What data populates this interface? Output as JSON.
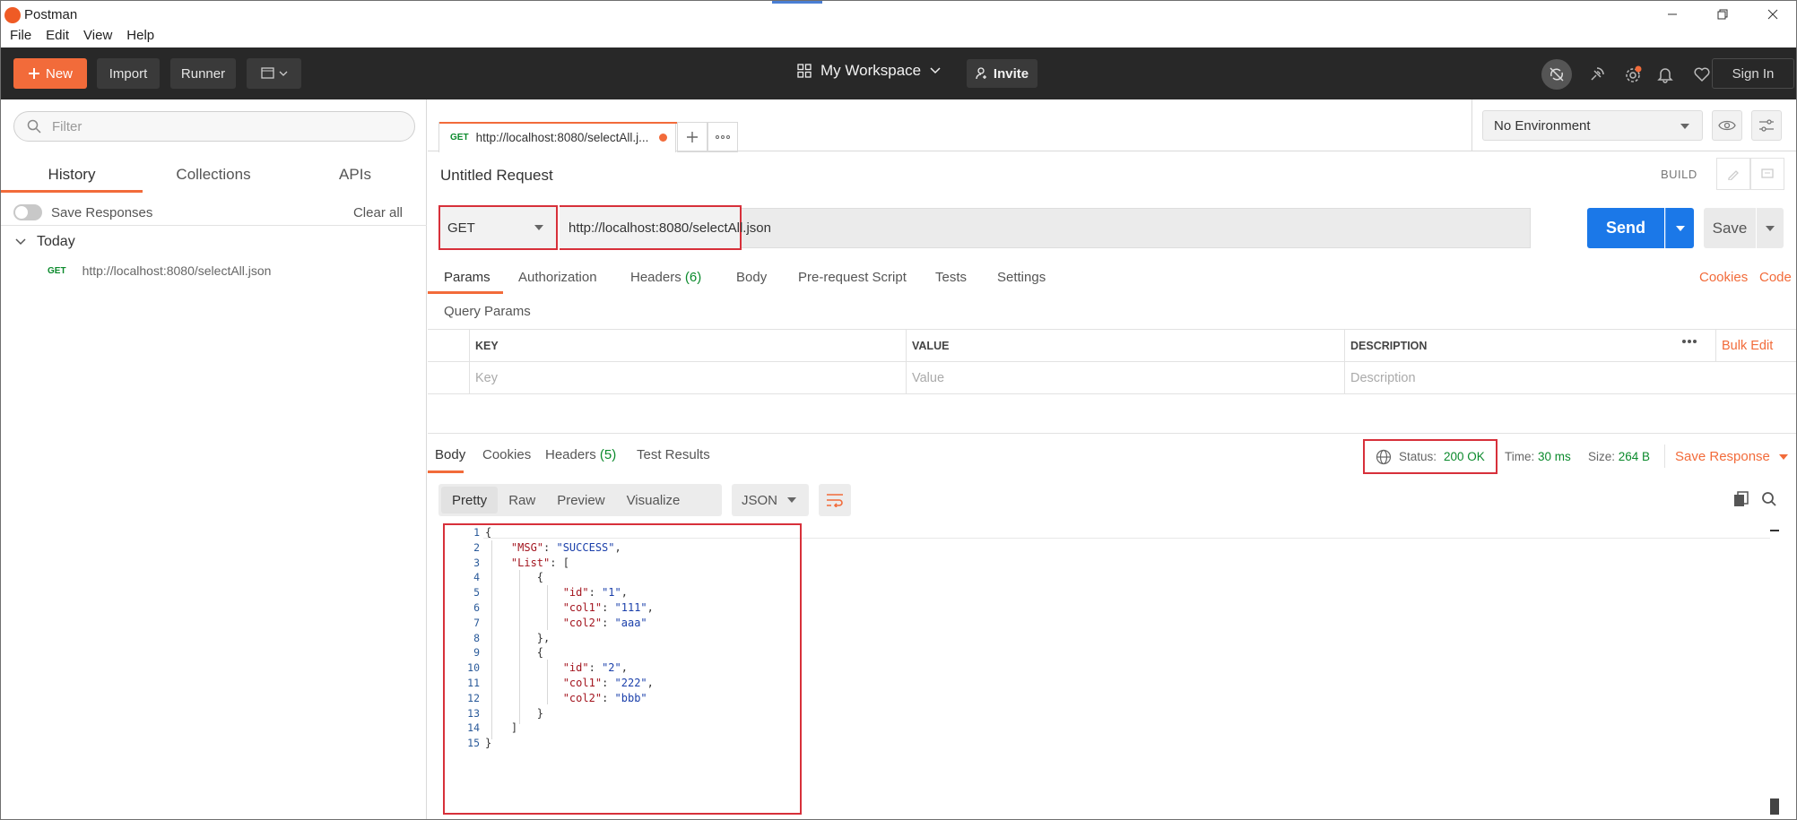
{
  "app": {
    "title": "Postman"
  },
  "menu": [
    "File",
    "Edit",
    "View",
    "Help"
  ],
  "toolbar": {
    "new_label": "New",
    "import_label": "Import",
    "runner_label": "Runner",
    "workspace_label": "My Workspace",
    "invite_label": "Invite",
    "signin_label": "Sign In"
  },
  "sidebar": {
    "filter_placeholder": "Filter",
    "tabs": [
      "History",
      "Collections",
      "APIs"
    ],
    "save_responses_label": "Save Responses",
    "clear_all_label": "Clear all",
    "group_label": "Today",
    "items": [
      {
        "method": "GET",
        "url": "http://localhost:8080/selectAll.json"
      }
    ]
  },
  "request_tab": {
    "method": "GET",
    "title": "http://localhost:8080/selectAll.j..."
  },
  "environment": {
    "selected": "No Environment"
  },
  "request": {
    "name": "Untitled Request",
    "build_label": "BUILD",
    "method": "GET",
    "url": "http://localhost:8080/selectAll.json",
    "send_label": "Send",
    "save_label": "Save",
    "tabs": {
      "params": "Params",
      "authorization": "Authorization",
      "headers": "Headers",
      "headers_count": "(6)",
      "body": "Body",
      "prerequest": "Pre-request Script",
      "tests": "Tests",
      "settings": "Settings"
    },
    "cookies_label": "Cookies",
    "code_label": "Code",
    "query_params_label": "Query Params",
    "table_headers": {
      "key": "KEY",
      "value": "VALUE",
      "description": "DESCRIPTION",
      "bulk_edit": "Bulk Edit"
    },
    "placeholders": {
      "key": "Key",
      "value": "Value",
      "description": "Description"
    }
  },
  "response": {
    "tabs": {
      "body": "Body",
      "cookies": "Cookies",
      "headers": "Headers",
      "headers_count": "(5)",
      "test_results": "Test Results"
    },
    "status_label": "Status:",
    "status_value": "200 OK",
    "time_label": "Time:",
    "time_value": "30 ms",
    "size_label": "Size:",
    "size_value": "264 B",
    "save_response_label": "Save Response",
    "views": [
      "Pretty",
      "Raw",
      "Preview",
      "Visualize"
    ],
    "format": "JSON",
    "line_numbers": [
      "1",
      "2",
      "3",
      "4",
      "5",
      "6",
      "7",
      "8",
      "9",
      "10",
      "11",
      "12",
      "13",
      "14",
      "15"
    ],
    "body": {
      "msg_key": "\"MSG\"",
      "msg_value": "\"SUCCESS\"",
      "list_key": "\"List\"",
      "id_key": "\"id\"",
      "col1_key": "\"col1\"",
      "col2_key": "\"col2\"",
      "item1_id": "\"1\"",
      "item1_col1": "\"111\"",
      "item1_col2": "\"aaa\"",
      "item2_id": "\"2\"",
      "item2_col1": "\"222\"",
      "item2_col2": "\"bbb\""
    }
  },
  "colors": {
    "accent": "#f26b3a",
    "send": "#1b78e8",
    "status_ok": "#0b8a2c",
    "highlight": "#d7303a"
  }
}
